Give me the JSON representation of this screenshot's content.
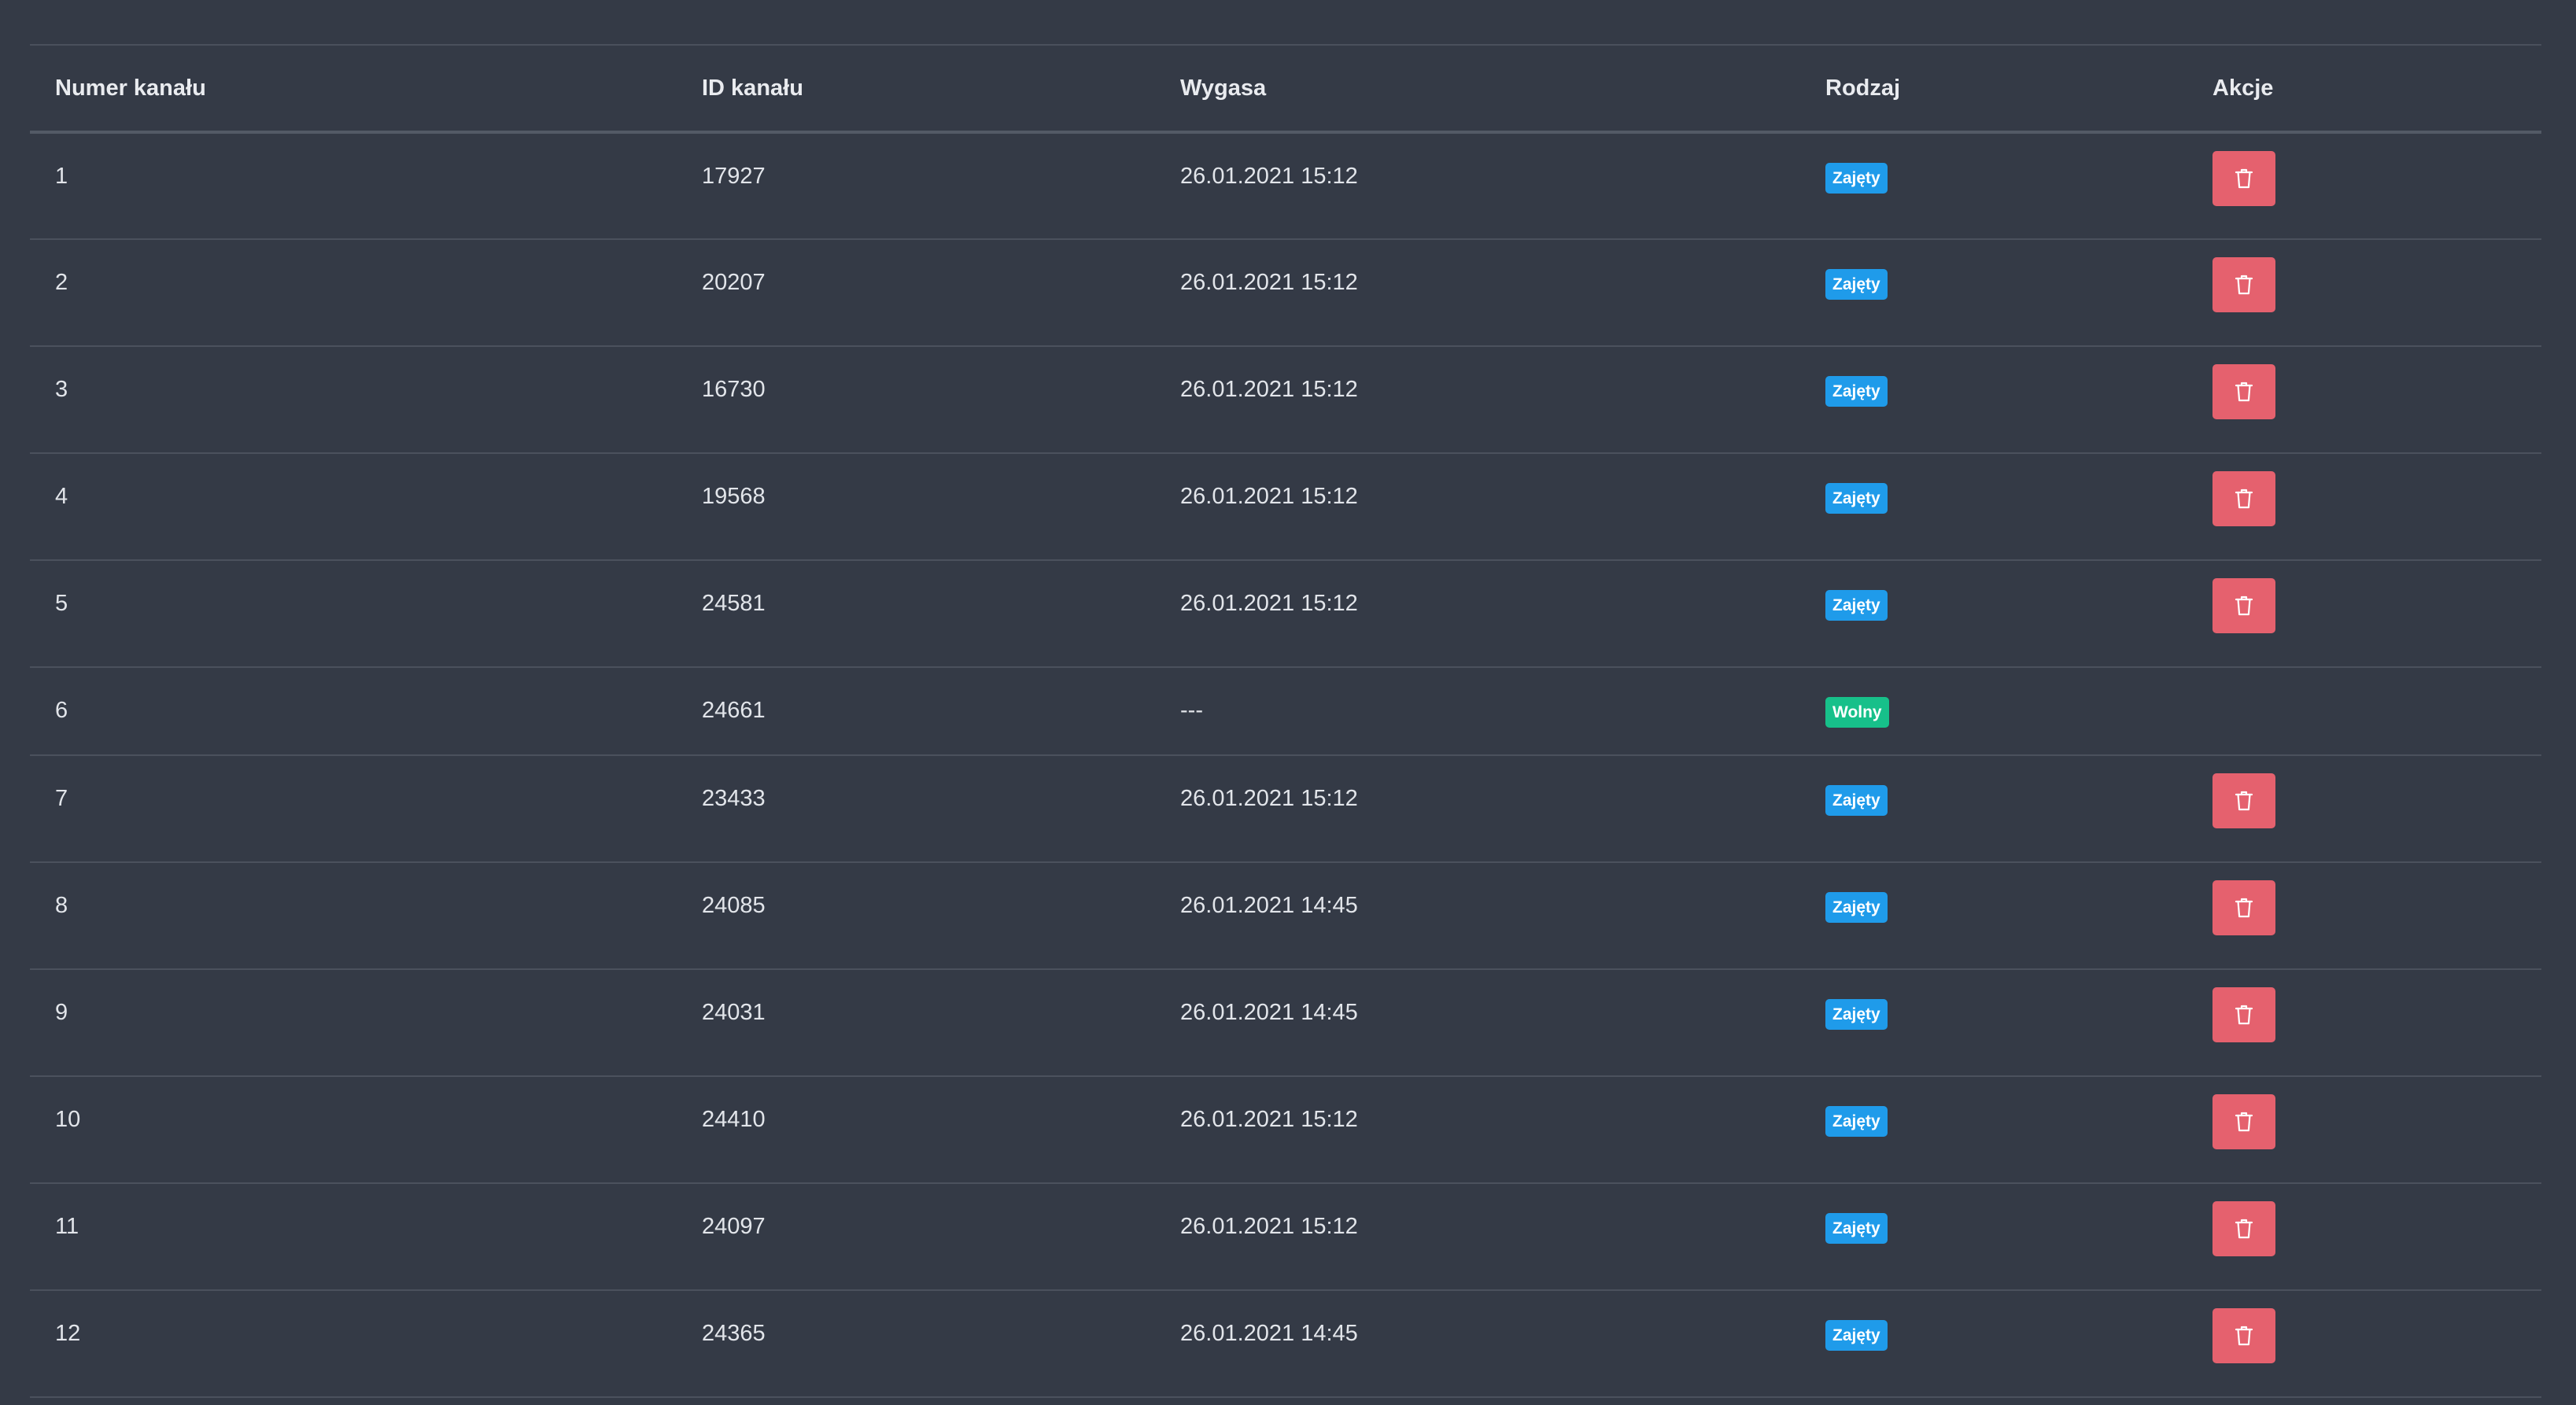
{
  "table": {
    "headers": [
      "Numer kanału",
      "ID kanału",
      "Wygasa",
      "Rodzaj",
      "Akcje"
    ],
    "colors": {
      "busy_badge": "#1f9bea",
      "free_badge": "#17c08a",
      "delete_button": "#e5616e",
      "background": "#343a46"
    },
    "rows": [
      {
        "number": "1",
        "id": "17927",
        "expires": "26.01.2021 15:12",
        "type": "Zajęty",
        "status": "busy",
        "action": "trash-icon"
      },
      {
        "number": "2",
        "id": "20207",
        "expires": "26.01.2021 15:12",
        "type": "Zajęty",
        "status": "busy",
        "action": "trash-icon"
      },
      {
        "number": "3",
        "id": "16730",
        "expires": "26.01.2021 15:12",
        "type": "Zajęty",
        "status": "busy",
        "action": "trash-icon"
      },
      {
        "number": "4",
        "id": "19568",
        "expires": "26.01.2021 15:12",
        "type": "Zajęty",
        "status": "busy",
        "action": "trash-icon"
      },
      {
        "number": "5",
        "id": "24581",
        "expires": "26.01.2021 15:12",
        "type": "Zajęty",
        "status": "busy",
        "action": "trash-icon"
      },
      {
        "number": "6",
        "id": "24661",
        "expires": "---",
        "type": "Wolny",
        "status": "free",
        "action": null
      },
      {
        "number": "7",
        "id": "23433",
        "expires": "26.01.2021 15:12",
        "type": "Zajęty",
        "status": "busy",
        "action": "trash-icon"
      },
      {
        "number": "8",
        "id": "24085",
        "expires": "26.01.2021 14:45",
        "type": "Zajęty",
        "status": "busy",
        "action": "trash-icon"
      },
      {
        "number": "9",
        "id": "24031",
        "expires": "26.01.2021 14:45",
        "type": "Zajęty",
        "status": "busy",
        "action": "trash-icon"
      },
      {
        "number": "10",
        "id": "24410",
        "expires": "26.01.2021 15:12",
        "type": "Zajęty",
        "status": "busy",
        "action": "trash-icon"
      },
      {
        "number": "11",
        "id": "24097",
        "expires": "26.01.2021 15:12",
        "type": "Zajęty",
        "status": "busy",
        "action": "trash-icon"
      },
      {
        "number": "12",
        "id": "24365",
        "expires": "26.01.2021 14:45",
        "type": "Zajęty",
        "status": "busy",
        "action": "trash-icon"
      }
    ]
  }
}
